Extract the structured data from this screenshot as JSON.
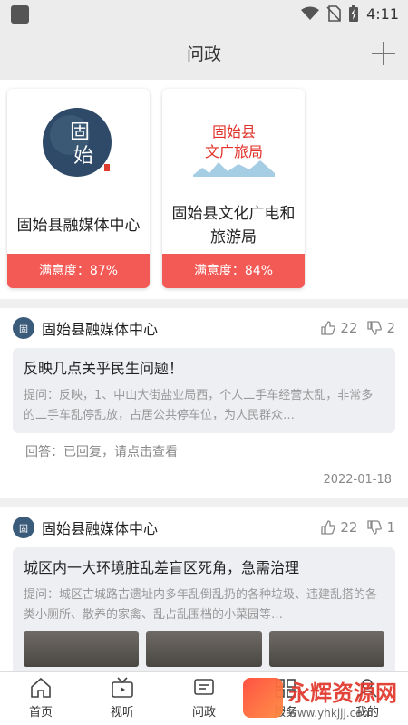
{
  "status": {
    "time": "4:11"
  },
  "header": {
    "title": "问政"
  },
  "cards": [
    {
      "name": "固始县融媒体中心",
      "satisfaction": "满意度：87%",
      "logo_text": "固始"
    },
    {
      "name": "固始县文化广电和旅游局",
      "satisfaction": "满意度：84%",
      "logo_text": "固始县\n文广旅局"
    }
  ],
  "posts": [
    {
      "org": "固始县融媒体中心",
      "up": "22",
      "down": "2",
      "title": "反映几点关乎民生问题！",
      "text": "提问：反映，1、中山大街盐业局西，个人二手车经营太乱，非常多的二手车乱停乱放，占居公共停车位，为人民群众…",
      "answer": "回答：已回复，请点击查看",
      "date": "2022-01-18"
    },
    {
      "org": "固始县融媒体中心",
      "up": "22",
      "down": "1",
      "title": "城区内一大环境脏乱差盲区死角，急需治理",
      "text": "提问：城区古城路古遗址内多年乱倒乱扔的各种垃圾、违建乱搭的各类小厕所、散养的家禽、乱占乱围档的小菜园等…"
    }
  ],
  "tabs": [
    {
      "label": "首页",
      "icon": "home-icon"
    },
    {
      "label": "视听",
      "icon": "tv-icon"
    },
    {
      "label": "问政",
      "icon": "ask-icon"
    },
    {
      "label": "服务",
      "icon": "service-icon"
    },
    {
      "label": "我的",
      "icon": "profile-icon"
    }
  ],
  "watermark": {
    "title": "永辉资源网",
    "url": "www.yhkjjj.com"
  },
  "colors": {
    "accent": "#f35a56"
  }
}
